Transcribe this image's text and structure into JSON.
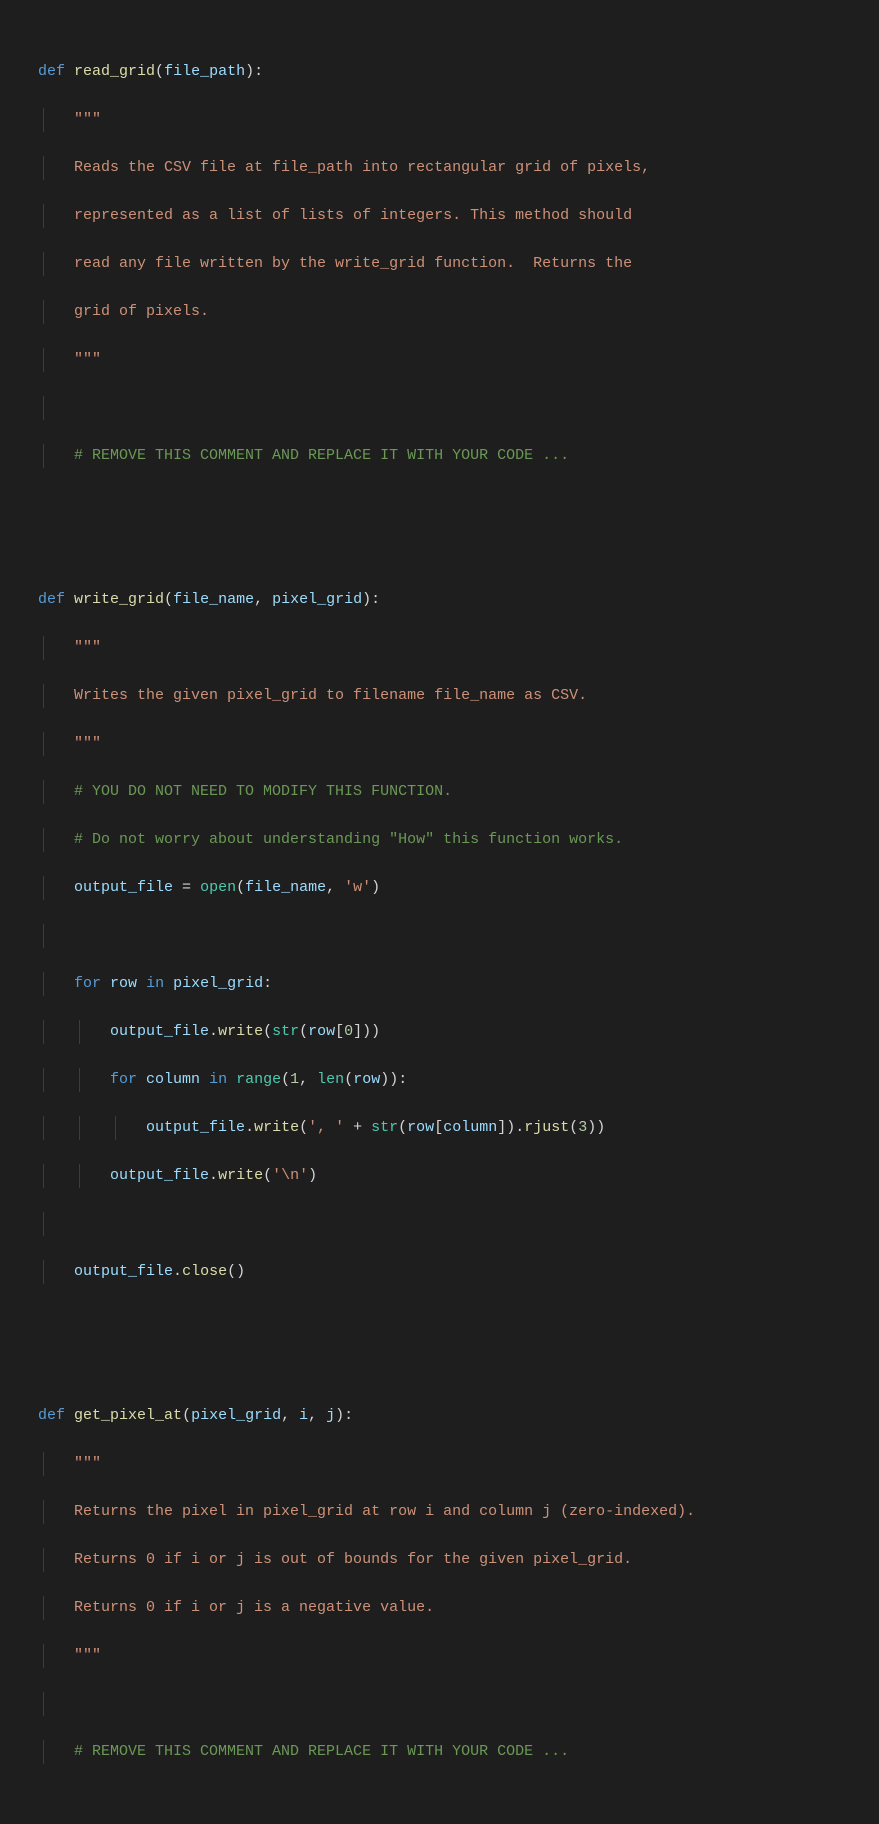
{
  "code": {
    "l1_def": "def",
    "l1_fn": "read_grid",
    "l1_p1": "file_path",
    "l2_q": "\"\"\"",
    "l3": "Reads the CSV file at file_path into rectangular grid of pixels,",
    "l4": "represented as a list of lists of integers. This method should",
    "l5": "read any file written by the write_grid function.  Returns the",
    "l6": "grid of pixels.",
    "l7_q": "\"\"\"",
    "l9": "# REMOVE THIS COMMENT AND REPLACE IT WITH YOUR CODE ...",
    "l12_def": "def",
    "l12_fn": "write_grid",
    "l12_p1": "file_name",
    "l12_p2": "pixel_grid",
    "l13_q": "\"\"\"",
    "l14": "Writes the given pixel_grid to filename file_name as CSV.",
    "l15_q": "\"\"\"",
    "l16": "# YOU DO NOT NEED TO MODIFY THIS FUNCTION.",
    "l17": "# Do not worry about understanding \"How\" this function works.",
    "l18_output_file": "output_file",
    "l18_open": "open",
    "l18_file_name": "file_name",
    "l18_w": "'w'",
    "l20_for": "for",
    "l20_row": "row",
    "l20_in": "in",
    "l20_pixel_grid": "pixel_grid",
    "l21_output_file": "output_file",
    "l21_write": "write",
    "l21_str": "str",
    "l21_row": "row",
    "l21_0": "0",
    "l22_for": "for",
    "l22_column": "column",
    "l22_in": "in",
    "l22_range": "range",
    "l22_1": "1",
    "l22_len": "len",
    "l22_row": "row",
    "l23_output_file": "output_file",
    "l23_write": "write",
    "l23_s1": "', '",
    "l23_str": "str",
    "l23_row": "row",
    "l23_column": "column",
    "l23_rjust": "rjust",
    "l23_3": "3",
    "l24_output_file": "output_file",
    "l24_write": "write",
    "l24_nl": "'\\n'",
    "l26_output_file": "output_file",
    "l26_close": "close",
    "l29_def": "def",
    "l29_fn": "get_pixel_at",
    "l29_p1": "pixel_grid",
    "l29_p2": "i",
    "l29_p3": "j",
    "l30_q": "\"\"\"",
    "l31": "Returns the pixel in pixel_grid at row i and column j (zero-indexed).",
    "l32": "Returns 0 if i or j is out of bounds for the given pixel_grid.",
    "l33": "Returns 0 if i or j is a negative value.",
    "l34_q": "\"\"\"",
    "l36": "# REMOVE THIS COMMENT AND REPLACE IT WITH YOUR CODE ..."
  }
}
